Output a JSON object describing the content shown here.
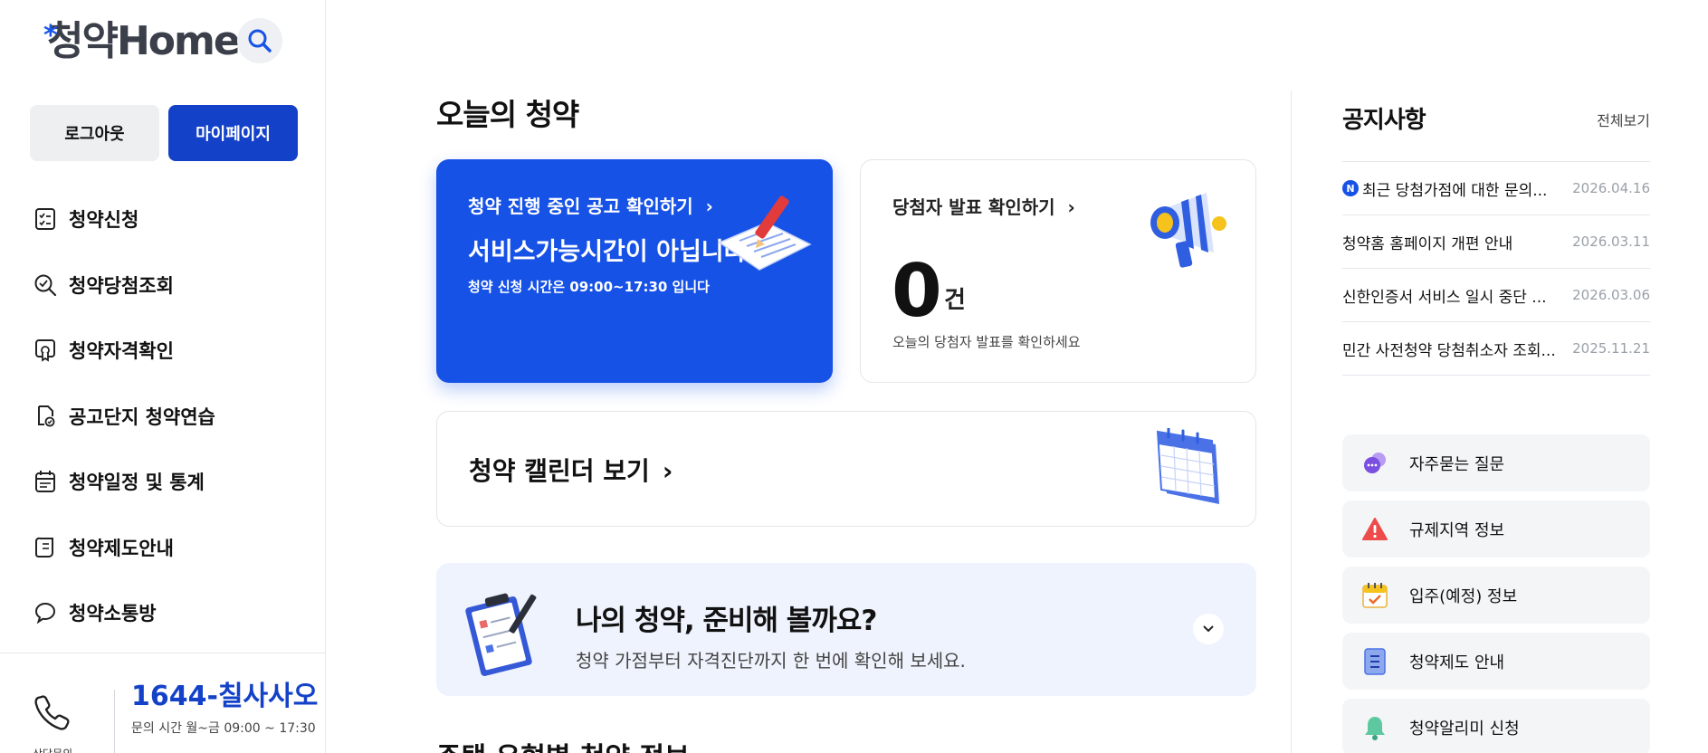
{
  "brand": {
    "logo_text": "청약Home",
    "accent": "#1752e6",
    "dark_blue": "#1341c8"
  },
  "sidebar": {
    "logout_label": "로그아웃",
    "mypage_label": "마이페이지",
    "items": [
      {
        "label": "청약신청",
        "icon": "checklist-icon"
      },
      {
        "label": "청약당첨조회",
        "icon": "search-check-icon"
      },
      {
        "label": "청약자격확인",
        "icon": "certificate-icon"
      },
      {
        "label": "공고단지 청약연습",
        "icon": "practice-icon"
      },
      {
        "label": "청약일정 및 통계",
        "icon": "calendar-icon"
      },
      {
        "label": "청약제도안내",
        "icon": "scroll-icon"
      },
      {
        "label": "청약소통방",
        "icon": "chat-bubble-icon"
      }
    ],
    "contact": {
      "number": "1644-칠사사오",
      "hours": "문의 시간 월~금 09:00 ~ 17:30",
      "phone_label": "상담문의"
    }
  },
  "main": {
    "title": "오늘의 청약",
    "card_apply": {
      "title": "청약 진행 중인 공고 확인하기",
      "status": "서비스가능시간이 아닙니다",
      "note": "청약 신청 시간은 09:00~17:30 입니다"
    },
    "card_winner": {
      "title": "당첨자 발표 확인하기",
      "count": "0",
      "unit": "건",
      "note": "오늘의 당첨자 발표를 확인하세요"
    },
    "calendar": {
      "title": "청약 캘린더 보기"
    },
    "prepare": {
      "title": "나의 청약, 준비해 볼까요?",
      "subtitle": "청약 가점부터 자격진단까지 한 번에 확인해 보세요."
    },
    "next_section_title": "주택 유형별 청약 정보"
  },
  "notices": {
    "title": "공지사항",
    "view_all": "전체보기",
    "items": [
      {
        "title": "최근 당첨가점에 대한 문의...",
        "date": "2026.04.16",
        "new": "N"
      },
      {
        "title": "청약홈 홈페이지 개편 안내",
        "date": "2026.03.11"
      },
      {
        "title": "신한인증서 서비스 일시 중단 ...",
        "date": "2026.03.06"
      },
      {
        "title": "민간 사전청약 당첨취소자 조회...",
        "date": "2025.11.21"
      }
    ]
  },
  "quick_links": [
    {
      "label": "자주묻는 질문",
      "icon": "faq-chat-icon"
    },
    {
      "label": "규제지역 정보",
      "icon": "warning-icon"
    },
    {
      "label": "입주(예정) 정보",
      "icon": "move-in-calendar-icon"
    },
    {
      "label": "청약제도 안내",
      "icon": "document-icon"
    },
    {
      "label": "청약알리미 신청",
      "icon": "bell-icon"
    }
  ]
}
